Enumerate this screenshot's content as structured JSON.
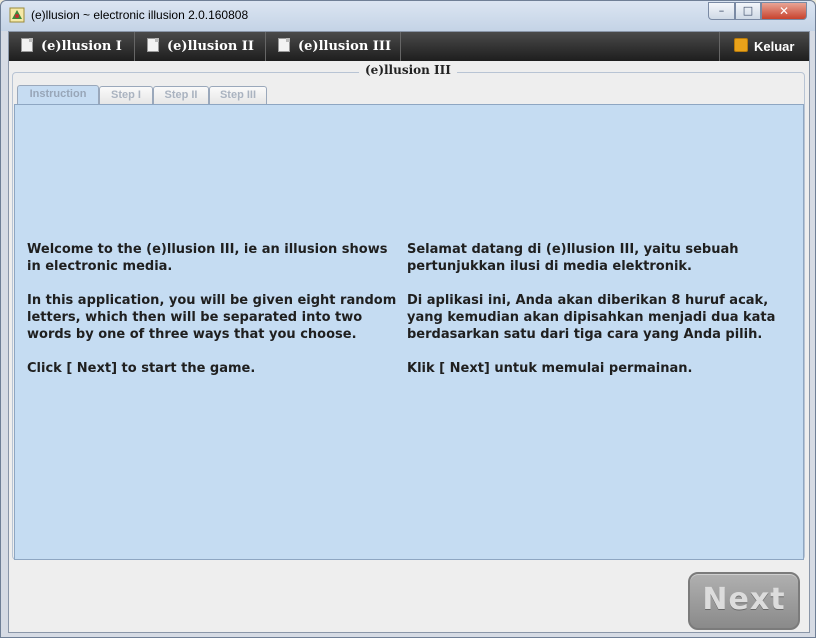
{
  "window": {
    "title": "(e)llusion ~ electronic illusion 2.0.160808",
    "minimize_glyph": "–",
    "maximize_glyph": "□",
    "close_glyph": "✕"
  },
  "menu": {
    "items": [
      {
        "label": "(e)llusion I",
        "icon": "document-icon"
      },
      {
        "label": "(e)llusion II",
        "icon": "document-icon"
      },
      {
        "label": "(e)llusion III",
        "icon": "document-icon"
      }
    ],
    "exit": {
      "label": "Keluar",
      "icon": "exit-icon"
    }
  },
  "group": {
    "title": "(e)llusion III"
  },
  "tabs": [
    {
      "label": "Instruction",
      "active": true
    },
    {
      "label": "Step I",
      "active": false
    },
    {
      "label": "Step II",
      "active": false
    },
    {
      "label": "Step III",
      "active": false
    }
  ],
  "instructions": {
    "en": [
      "Welcome to the (e)llusion III, ie an illusion shows in electronic media.",
      "In this application, you will be given eight random letters, which then will be separated into two words by one of three ways that you choose.",
      "Click [ Next] to start the game."
    ],
    "id": [
      "Selamat datang di (e)llusion III, yaitu sebuah pertunjukkan ilusi di media elektronik.",
      "Di aplikasi ini, Anda akan diberikan 8 huruf acak, yang kemudian akan dipisahkan menjadi dua kata berdasarkan satu dari tiga cara yang Anda pilih.",
      "Klik [ Next] untuk memulai permainan."
    ]
  },
  "next_button": {
    "label": "Next"
  },
  "colors": {
    "panel": "#c5dcf2",
    "menubar": "#2a2a2a",
    "exit_icon": "#e9a21a"
  }
}
